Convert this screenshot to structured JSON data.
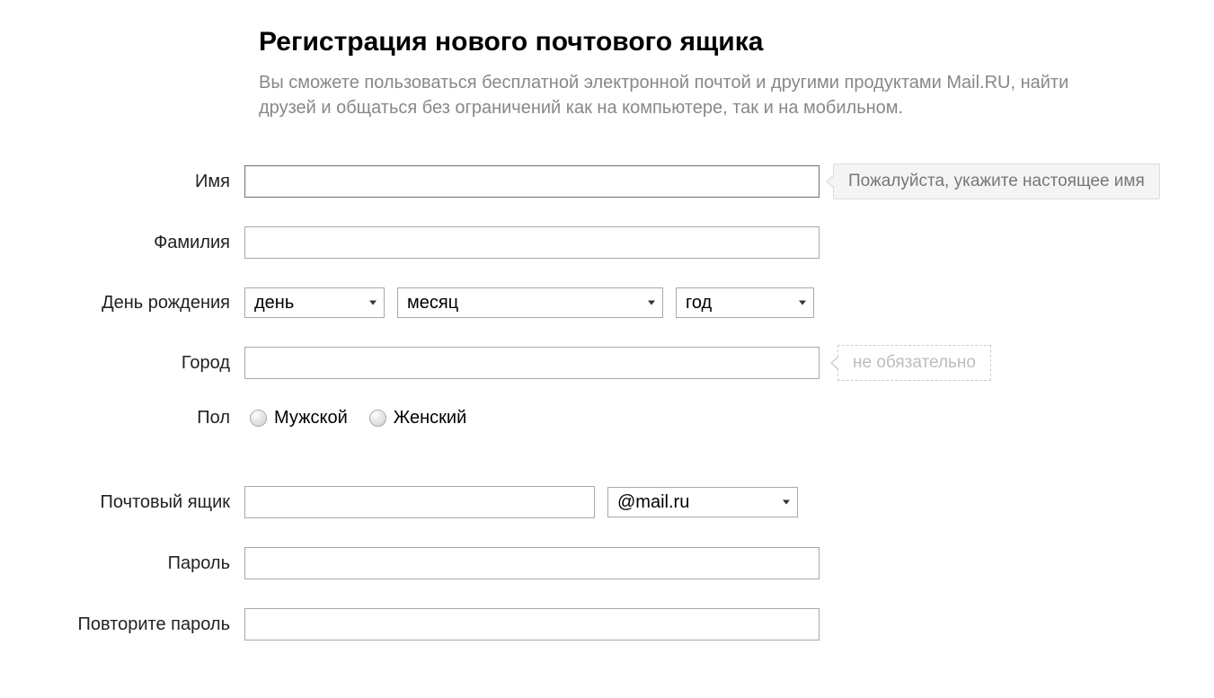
{
  "header": {
    "title": "Регистрация нового почтового ящика",
    "subtitle": "Вы сможете пользоваться бесплатной электронной почтой и другими продуктами Mail.RU, найти друзей и общаться без ограничений как на компьютере, так и на мобильном."
  },
  "labels": {
    "first_name": "Имя",
    "last_name": "Фамилия",
    "birthday": "День рождения",
    "city": "Город",
    "gender": "Пол",
    "mailbox": "Почтовый ящик",
    "password": "Пароль",
    "password_repeat": "Повторите пароль"
  },
  "birthday": {
    "day": "день",
    "month": "месяц",
    "year": "год"
  },
  "gender": {
    "male": "Мужской",
    "female": "Женский"
  },
  "mailbox": {
    "domain": "@mail.ru"
  },
  "hints": {
    "first_name_tip": "Пожалуйста, укажите настоящее имя",
    "city_optional": "не обязательно"
  }
}
